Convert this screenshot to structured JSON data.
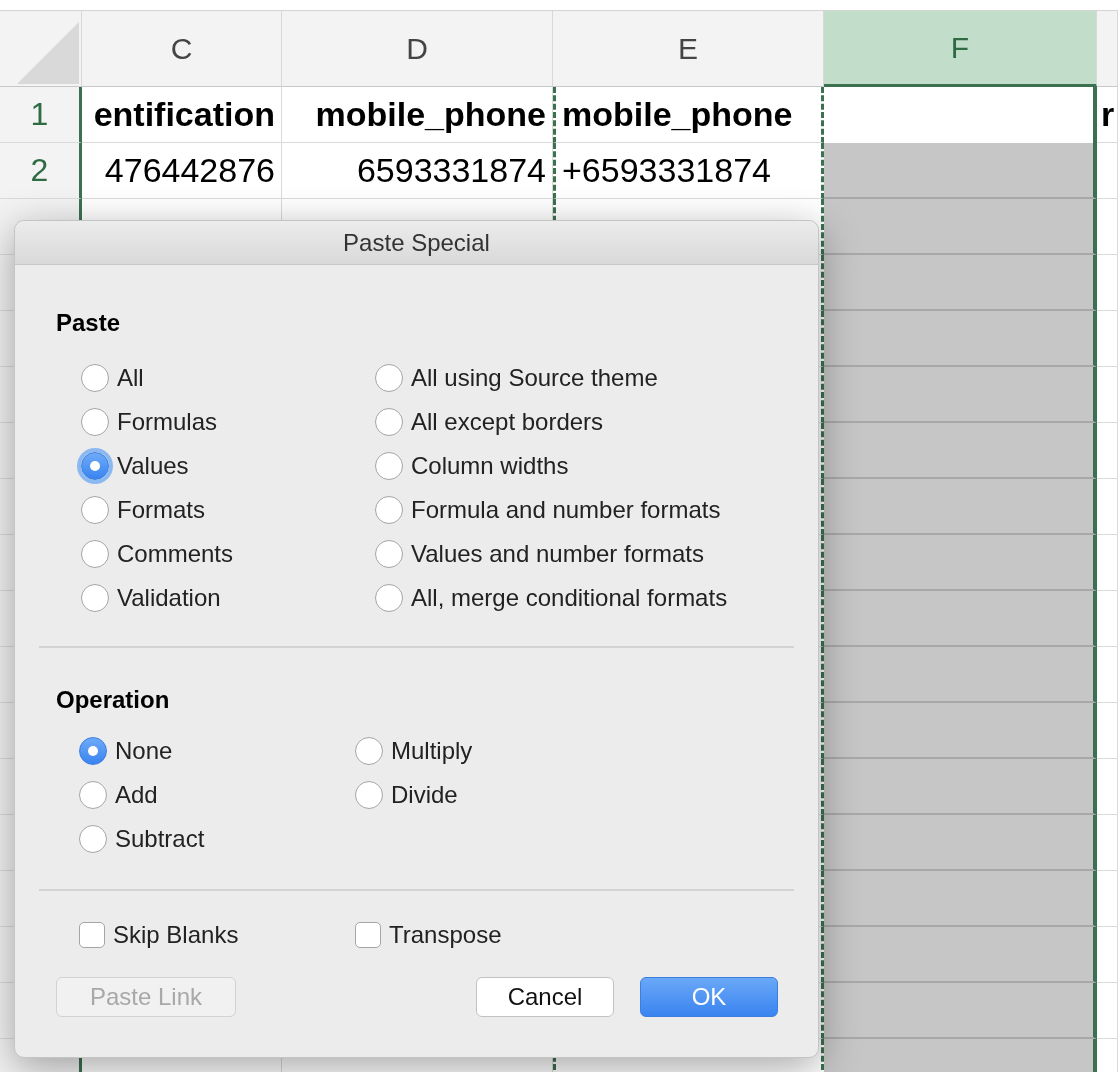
{
  "sheet": {
    "columns": [
      {
        "label": "C",
        "selected": false
      },
      {
        "label": "D",
        "selected": false
      },
      {
        "label": "E",
        "selected": false
      },
      {
        "label": "F",
        "selected": true
      }
    ],
    "rows": [
      {
        "number": "1",
        "kind": "header",
        "cells": {
          "c": "entification",
          "d": "mobile_phone",
          "e": "mobile_phone",
          "g": "r"
        }
      },
      {
        "number": "2",
        "kind": "data",
        "cells": {
          "c": "476442876",
          "d": "6593331874",
          "e": "+6593331874"
        }
      }
    ]
  },
  "dialog": {
    "title": "Paste Special",
    "paste": {
      "heading": "Paste",
      "options": [
        {
          "label": "All",
          "selected": false,
          "focused": false
        },
        {
          "label": "Formulas",
          "selected": false,
          "focused": false
        },
        {
          "label": "Values",
          "selected": true,
          "focused": true
        },
        {
          "label": "Formats",
          "selected": false,
          "focused": false
        },
        {
          "label": "Comments",
          "selected": false,
          "focused": false
        },
        {
          "label": "Validation",
          "selected": false,
          "focused": false
        },
        {
          "label": "All using Source theme",
          "selected": false,
          "focused": false
        },
        {
          "label": "All except borders",
          "selected": false,
          "focused": false
        },
        {
          "label": "Column widths",
          "selected": false,
          "focused": false
        },
        {
          "label": "Formula and number formats",
          "selected": false,
          "focused": false
        },
        {
          "label": "Values and number formats",
          "selected": false,
          "focused": false
        },
        {
          "label": "All, merge conditional formats",
          "selected": false,
          "focused": false
        }
      ]
    },
    "operation": {
      "heading": "Operation",
      "options": [
        {
          "label": "None",
          "selected": true
        },
        {
          "label": "Add",
          "selected": false
        },
        {
          "label": "Subtract",
          "selected": false
        },
        {
          "label": "Multiply",
          "selected": false
        },
        {
          "label": "Divide",
          "selected": false
        }
      ]
    },
    "checkboxes": [
      {
        "label": "Skip Blanks",
        "checked": false
      },
      {
        "label": "Transpose",
        "checked": false
      }
    ],
    "buttons": [
      {
        "label": "Paste Link",
        "kind": "normal",
        "disabled": true
      },
      {
        "label": "Cancel",
        "kind": "normal",
        "disabled": false
      },
      {
        "label": "OK",
        "kind": "default",
        "disabled": false
      }
    ]
  }
}
